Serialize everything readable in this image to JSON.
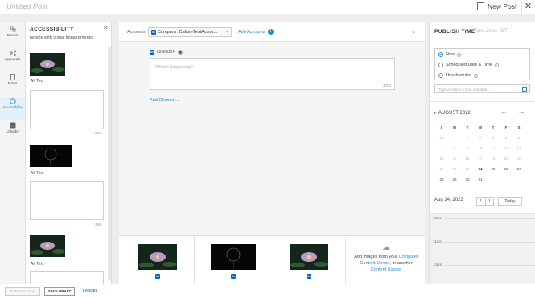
{
  "header": {
    "title": "Untitled Post",
    "new_post": "New Post"
  },
  "nav": [
    {
      "label": "Basics",
      "icon": "basics-icon"
    },
    {
      "label": "Approvals",
      "icon": "approvals-icon"
    },
    {
      "label": "Notes",
      "icon": "notes-icon"
    },
    {
      "label": "Accessibility",
      "icon": "accessibility-icon",
      "active": true
    },
    {
      "label": "LinkedIn",
      "icon": "linkedin-icon"
    }
  ],
  "accessibility": {
    "title": "ACCESSIBILITY",
    "subtitle": "people with visual impairements.",
    "alt_label": "Alt Text",
    "count": "256"
  },
  "accounts": {
    "label": "Accounts:",
    "selected": "Company: CalibreTestAccou...",
    "add": "Add Accounts"
  },
  "composer": {
    "network": "LINKEDIN",
    "placeholder": "What's happening?",
    "count": "3000",
    "add_channel": "Add Channel..."
  },
  "upload": {
    "line1": "Add images from your",
    "link1": "Computer",
    "link2": "Content Center",
    "line2": ", or another",
    "link3": "Content Source"
  },
  "publish": {
    "title": "PUBLISH TIME",
    "timezone": "Time Zone: IST",
    "options": [
      "Now",
      "Scheduled Date & Time",
      "Unscheduled"
    ],
    "input_placeholder": "Type or select a time and date...",
    "month": "AUGUST 2022",
    "weekdays": [
      "S",
      "M",
      "T",
      "W",
      "T",
      "F",
      "S"
    ],
    "days": [
      [
        "31",
        "1",
        "2",
        "3",
        "4",
        "5",
        "6"
      ],
      [
        "7",
        "8",
        "9",
        "10",
        "11",
        "12",
        "13"
      ],
      [
        "14",
        "15",
        "16",
        "17",
        "18",
        "19",
        "20"
      ],
      [
        "21",
        "22",
        "23",
        "24",
        "25",
        "26",
        "27"
      ],
      [
        "28",
        "29",
        "30",
        "31",
        "",
        "",
        ""
      ]
    ],
    "date": "Aug 24, 2022",
    "today": "Today",
    "times": [
      "10am",
      "11am",
      "12pm"
    ]
  },
  "footer": {
    "publish_now": "PUBLISH NOW",
    "save_draft": "SAVE DRAFT",
    "cancel": "CANCEL"
  },
  "colors": {
    "accent": "#1a8ad1",
    "linkedin": "#0a66c2"
  }
}
